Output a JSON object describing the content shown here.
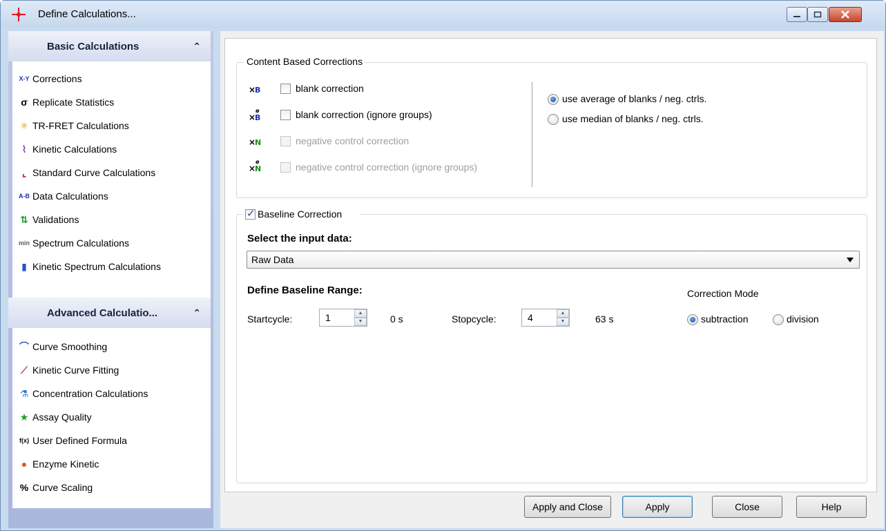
{
  "window": {
    "title": "Define Calculations...",
    "buttons": {
      "minimize": "–",
      "maximize": "□",
      "close": "✕"
    }
  },
  "sidebar": {
    "basic": {
      "header": "Basic Calculations",
      "chevron": "≈",
      "items": [
        {
          "label": "Corrections",
          "icon": "corrections-icon",
          "glyph": "X-Y"
        },
        {
          "label": "Replicate Statistics",
          "icon": "sigma-icon",
          "glyph": "σ"
        },
        {
          "label": "TR-FRET Calculations",
          "icon": "sun-icon",
          "glyph": "✳"
        },
        {
          "label": "Kinetic Calculations",
          "icon": "kinetic-chart-icon",
          "glyph": "⌇"
        },
        {
          "label": "Standard Curve Calculations",
          "icon": "standard-curve-icon",
          "glyph": "⌞"
        },
        {
          "label": "Data Calculations",
          "icon": "data-calc-icon",
          "glyph": "A-B"
        },
        {
          "label": "Validations",
          "icon": "validations-icon",
          "glyph": "⇅"
        },
        {
          "label": "Spectrum Calculations",
          "icon": "spectrum-icon",
          "glyph": "min"
        },
        {
          "label": "Kinetic Spectrum Calculations",
          "icon": "kinetic-spectrum-icon",
          "glyph": "▮"
        }
      ]
    },
    "advanced": {
      "header": "Advanced Calculatio...",
      "chevron": "≈",
      "items": [
        {
          "label": "Curve Smoothing",
          "icon": "curve-smoothing-icon",
          "glyph": "⌒"
        },
        {
          "label": "Kinetic Curve Fitting",
          "icon": "curve-fitting-icon",
          "glyph": "⟋"
        },
        {
          "label": "Concentration Calculations",
          "icon": "flask-icon",
          "glyph": "⚗"
        },
        {
          "label": "Assay Quality",
          "icon": "star-icon",
          "glyph": "★"
        },
        {
          "label": "User Defined Formula",
          "icon": "formula-icon",
          "glyph": "f(x)"
        },
        {
          "label": "Enzyme Kinetic",
          "icon": "enzyme-icon",
          "glyph": "●"
        },
        {
          "label": "Curve Scaling",
          "icon": "percent-icon",
          "glyph": "%"
        }
      ]
    }
  },
  "content_corrections": {
    "title": "Content Based Corrections",
    "checks": [
      {
        "label": "blank correction",
        "glyph": "X-B",
        "enabled": true,
        "checked": false
      },
      {
        "label": "blank correction (ignore groups)",
        "glyph": "X-B",
        "enabled": true,
        "checked": false
      },
      {
        "label": "negative control correction",
        "glyph": "X-N",
        "enabled": false,
        "checked": false
      },
      {
        "label": "negative control correction (ignore groups)",
        "glyph": "X-N",
        "enabled": false,
        "checked": false
      }
    ],
    "radios": [
      {
        "label": "use average of blanks / neg. ctrls.",
        "checked": true
      },
      {
        "label": "use median of blanks / neg. ctrls.",
        "checked": false
      }
    ]
  },
  "baseline": {
    "title": "Baseline Correction",
    "checked": true,
    "input_label": "Select the input data:",
    "input_value": "Raw Data",
    "range_label": "Define Baseline Range:",
    "start_label": "Startcycle:",
    "start_value": "1",
    "start_time": "0 s",
    "stop_label": "Stopcycle:",
    "stop_value": "4",
    "stop_time": "63 s",
    "mode_label": "Correction Mode",
    "modes": [
      {
        "label": "subtraction",
        "checked": true
      },
      {
        "label": "division",
        "checked": false
      }
    ]
  },
  "footer": {
    "apply_close": "Apply and Close",
    "apply": "Apply",
    "close": "Close",
    "help": "Help"
  },
  "colors": {
    "title_icon": "#e31b23",
    "accent_blue": "#1f4e9d",
    "close_button": "#c7442b"
  }
}
